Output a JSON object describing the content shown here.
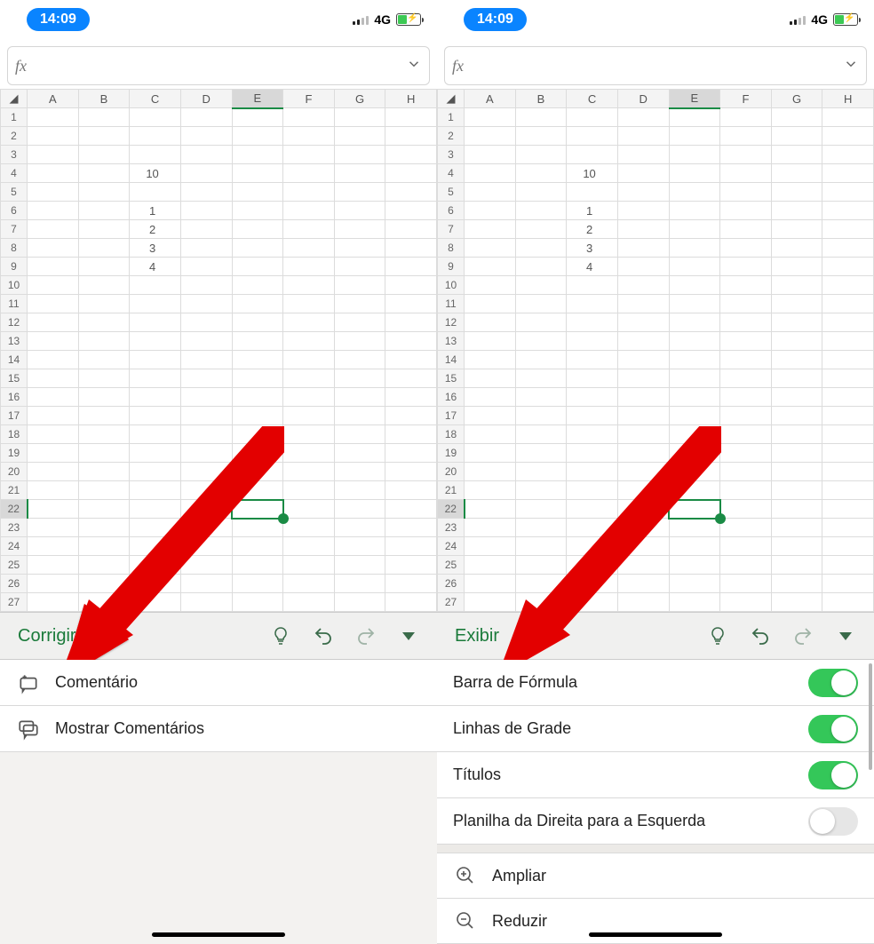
{
  "status": {
    "time": "14:09",
    "network": "4G"
  },
  "formula": {
    "fx": "fx",
    "value": ""
  },
  "sheet": {
    "columns": [
      "A",
      "B",
      "C",
      "D",
      "E",
      "F",
      "G",
      "H"
    ],
    "cells": {
      "C4": "10",
      "C6": "1",
      "C7": "2",
      "C8": "3",
      "C9": "4"
    },
    "selectedCol": "E",
    "selectedRow": 22
  },
  "left": {
    "tab": "Corrigir",
    "menu": {
      "comment": "Comentário",
      "showComments": "Mostrar Comentários"
    }
  },
  "right": {
    "tab": "Exibir",
    "menu": {
      "formulaBar": "Barra de Fórmula",
      "gridlines": "Linhas de Grade",
      "headings": "Títulos",
      "rtl": "Planilha da Direita para a Esquerda",
      "zoomIn": "Ampliar",
      "zoomOut": "Reduzir"
    },
    "toggles": {
      "formulaBar": true,
      "gridlines": true,
      "headings": true,
      "rtl": false
    }
  }
}
